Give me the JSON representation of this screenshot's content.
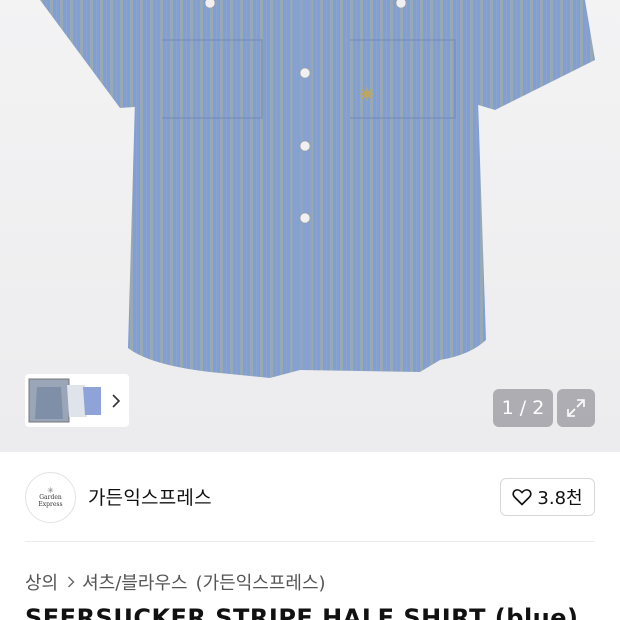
{
  "gallery": {
    "counter": "1 / 2",
    "image_alt": "blue seersucker stripe half shirt"
  },
  "brand": {
    "logo_text_line1": "Garden",
    "logo_text_line2": "Express",
    "name": "가든익스프레스"
  },
  "like": {
    "count": "3.8천"
  },
  "breadcrumb": {
    "level1": "상의",
    "level2": "셔츠/블라우스",
    "brand": "(가든익스프레스)"
  },
  "product": {
    "title": "SEERSUCKER STRIPE HALF SHIRT (blue)"
  },
  "colors": {
    "shirt_blue": "#7f9fd9",
    "stripe": "#9aa7a0",
    "overlay": "#78787d"
  },
  "icons": {
    "thumb_next": "chevron-right-icon",
    "expand": "expand-icon",
    "like": "heart-icon",
    "breadcrumb_sep": "chevron-right-icon"
  }
}
